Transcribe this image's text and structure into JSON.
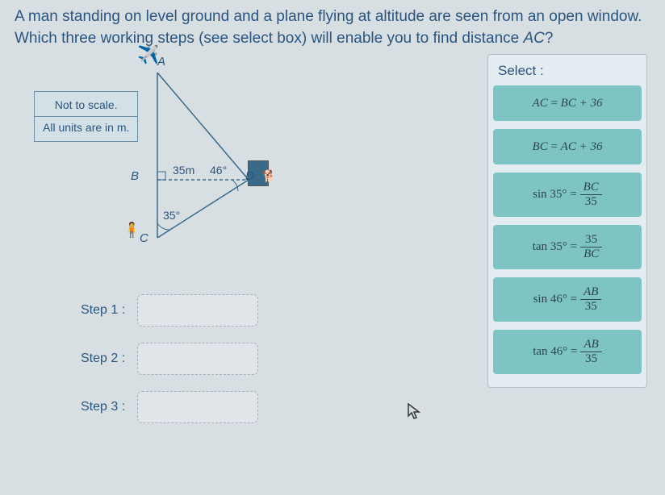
{
  "question": {
    "line1": "A man standing on level ground and a plane flying at altitude are seen from an open window.",
    "line2_pre": "Which three working steps (see select box) will enable you to find distance ",
    "line2_var": "AC",
    "line2_post": "?"
  },
  "note": {
    "line1": "Not to scale.",
    "line2": "All units are in m."
  },
  "diagram": {
    "A": "A",
    "B": "B",
    "C": "C",
    "D": "D",
    "len_BD": "35m",
    "angle_D": "46°",
    "angle_C": "35°"
  },
  "steps": {
    "s1": "Step 1 :",
    "s2": "Step 2 :",
    "s3": "Step 3 :"
  },
  "select": {
    "title": "Select :",
    "options": [
      {
        "lhs": "AC",
        "op": "=",
        "rhs_plain": "BC + 36"
      },
      {
        "lhs": "BC",
        "op": "=",
        "rhs_plain": "AC + 36"
      },
      {
        "lhs": "sin 35°",
        "op": "=",
        "frac_num": "BC",
        "frac_den": "35"
      },
      {
        "lhs": "tan 35°",
        "op": "=",
        "frac_num": "35",
        "frac_den": "BC"
      },
      {
        "lhs": "sin 46°",
        "op": "=",
        "frac_num": "AB",
        "frac_den": "35"
      },
      {
        "lhs": "tan 46°",
        "op": "=",
        "frac_num": "AB",
        "frac_den": "35"
      }
    ]
  }
}
